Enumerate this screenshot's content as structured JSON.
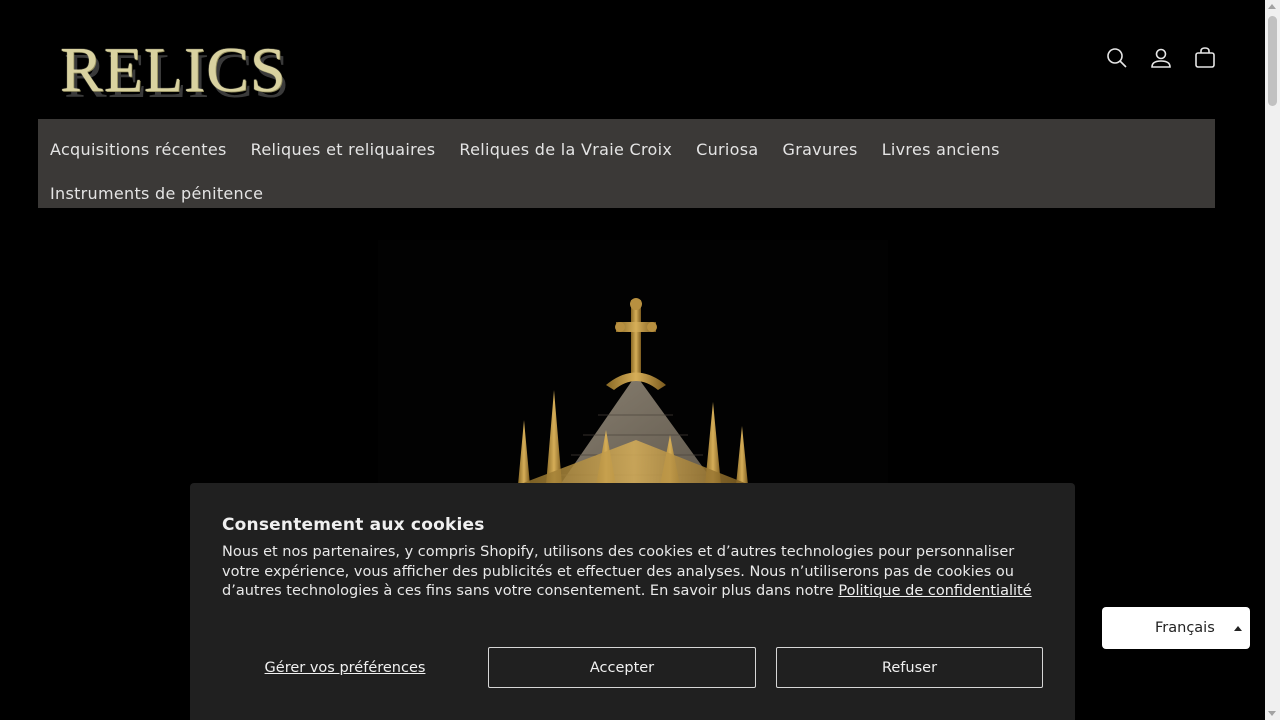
{
  "brand": {
    "logo_text": "RELICS"
  },
  "header": {
    "icons": [
      "search-icon",
      "account-icon",
      "cart-icon"
    ]
  },
  "nav": {
    "row1": [
      "Acquisitions récentes",
      "Reliques et reliquaires",
      "Reliques de la Vraie Croix",
      "Curiosa",
      "Gravures",
      "Livres anciens"
    ],
    "row2": [
      "Instruments de pénitence"
    ]
  },
  "cookie": {
    "title": "Consentement aux cookies",
    "text": "Nous et nos partenaires, y compris Shopify, utilisons des cookies et d’autres technologies pour personnaliser votre expérience, vous afficher des publicités et effectuer des analyses. Nous n’utiliserons pas de cookies ou d’autres technologies à ces fins sans votre consentement. En savoir plus dans notre ",
    "policy_link": "Politique de confidentialité",
    "manage_label": "Gérer vos préférences",
    "accept_label": "Accepter",
    "refuse_label": "Refuser"
  },
  "language": {
    "selected": "Français"
  },
  "colors": {
    "nav_bg": "#3b3937",
    "cookie_bg": "#202020",
    "logo_gold": "#d9d2a0",
    "reliquary_gold": "#c9a04a"
  }
}
